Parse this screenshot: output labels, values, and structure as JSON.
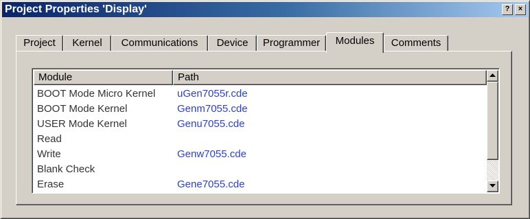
{
  "window": {
    "title": "Project Properties 'Display'",
    "help_button": "?",
    "close_button": "×"
  },
  "tabs": [
    {
      "label": "Project",
      "active": false
    },
    {
      "label": "Kernel",
      "active": false
    },
    {
      "label": "Communications",
      "active": false
    },
    {
      "label": "Device",
      "active": false
    },
    {
      "label": "Programmer",
      "active": false
    },
    {
      "label": "Modules",
      "active": true
    },
    {
      "label": "Comments",
      "active": false
    }
  ],
  "listview": {
    "columns": [
      "Module",
      "Path"
    ],
    "rows": [
      {
        "module": "BOOT Mode Micro Kernel",
        "path": "uGen7055r.cde"
      },
      {
        "module": "BOOT Mode Kernel",
        "path": "Genm7055.cde"
      },
      {
        "module": "USER Mode Kernel",
        "path": "Genu7055.cde"
      },
      {
        "module": "Read",
        "path": ""
      },
      {
        "module": "Write",
        "path": "Genw7055.cde"
      },
      {
        "module": "Blank Check",
        "path": ""
      },
      {
        "module": "Erase",
        "path": "Gene7055.cde"
      }
    ],
    "scroll_position": 0
  },
  "colors": {
    "title_gradient_start": "#0a246a",
    "title_gradient_end": "#a6caf0",
    "face": "#d4d0c8",
    "path_text": "#2a3ee8"
  },
  "icons": {
    "scroll_up": "triangle-up-icon",
    "scroll_down": "triangle-down-icon"
  }
}
